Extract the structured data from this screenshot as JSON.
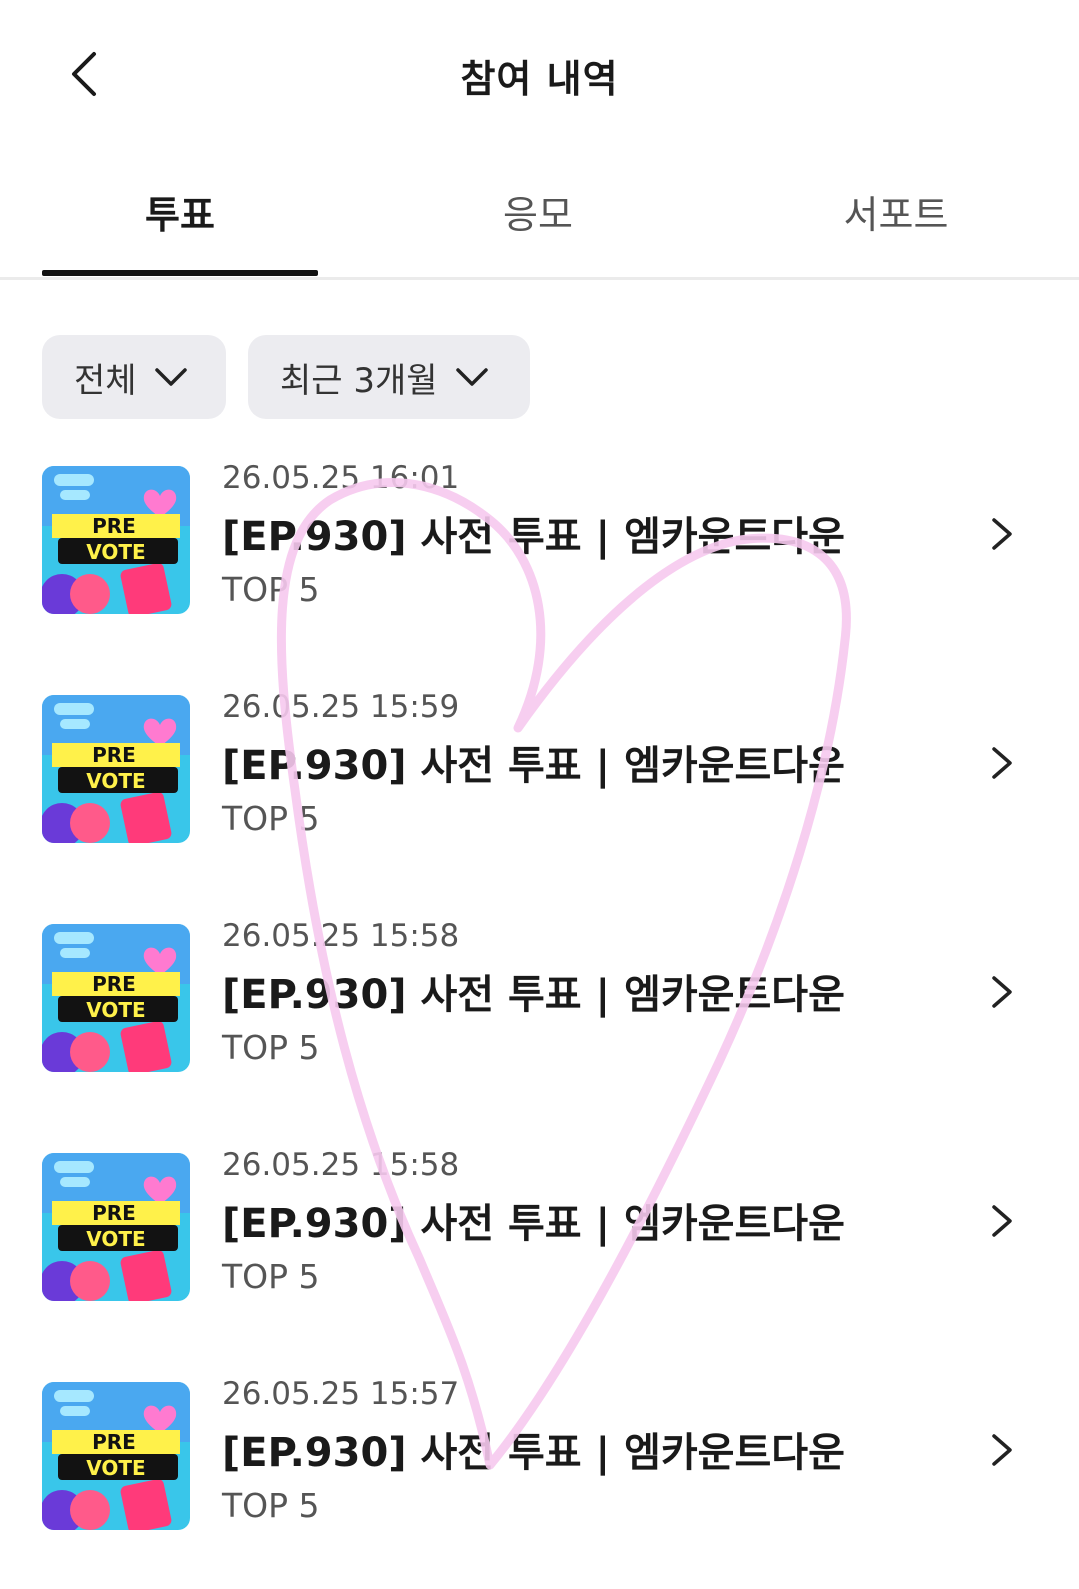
{
  "header": {
    "title": "참여 내역",
    "back_icon": "chevron-left-icon"
  },
  "tabs": [
    {
      "label": "투표",
      "active": true
    },
    {
      "label": "응모",
      "active": false
    },
    {
      "label": "서포트",
      "active": false
    }
  ],
  "filters": {
    "category": "전체",
    "period": "최근 3개월"
  },
  "thumbnail": {
    "line1": "PRE",
    "line2": "VOTE"
  },
  "items": [
    {
      "date": "26.05.25 16:01",
      "title": "[EP.930] 사전 투표 | 엠카운트다운",
      "rank": "TOP 5"
    },
    {
      "date": "26.05.25 15:59",
      "title": "[EP.930] 사전 투표 | 엠카운트다운",
      "rank": "TOP 5"
    },
    {
      "date": "26.05.25 15:58",
      "title": "[EP.930] 사전 투표 | 엠카운트다운",
      "rank": "TOP 5"
    },
    {
      "date": "26.05.25 15:58",
      "title": "[EP.930] 사전 투표 | 엠카운트다운",
      "rank": "TOP 5"
    },
    {
      "date": "26.05.25 15:57",
      "title": "[EP.930] 사전 투표 | 엠카운트다운",
      "rank": "TOP 5"
    }
  ],
  "colors": {
    "active_tab": "#111111",
    "chip_bg": "#ececf0",
    "heart_stroke": "#f6c9ee"
  }
}
